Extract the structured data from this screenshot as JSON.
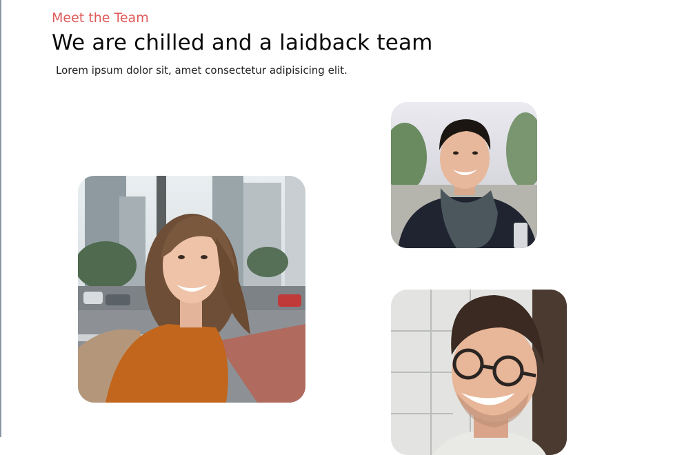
{
  "section": {
    "eyebrow": "Meet the Team",
    "title": "We are chilled and a laidback team",
    "subtitle": "Lorem ipsum dolor sit, amet consectetur adipisicing elit."
  },
  "colors": {
    "accent": "#e05a5a",
    "title": "#0a0a0a",
    "text": "#222222"
  },
  "team_photos": [
    {
      "icon": "smiling-woman-photo"
    },
    {
      "icon": "smiling-man-scarf-photo"
    },
    {
      "icon": "laughing-man-glasses-photo"
    }
  ]
}
